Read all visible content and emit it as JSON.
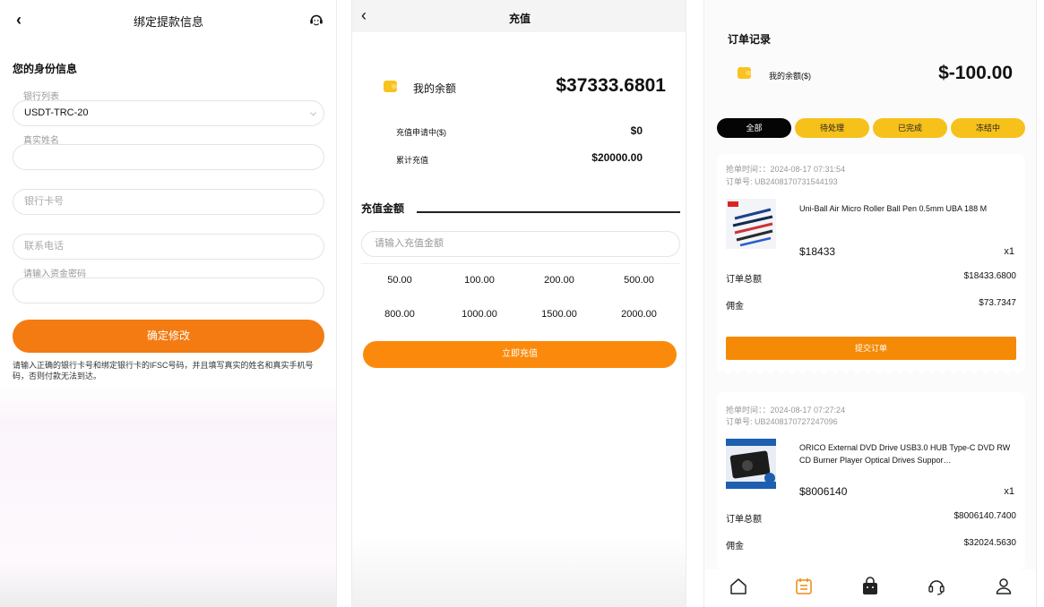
{
  "panel1": {
    "back_glyph": "‹",
    "title": "绑定提款信息",
    "section_title": "您的身份信息",
    "bank_list_label": "银行列表",
    "bank_list_value": "USDT-TRC-20",
    "real_name_label": "真实姓名",
    "card_placeholder": "银行卡号",
    "phone_placeholder": "联系电话",
    "fund_password_label": "请输入资金密码",
    "confirm_label": "确定修改",
    "note": "请输入正确的银行卡号和绑定银行卡的IFSC号码，并且填写真实的姓名和真实手机号码，否则付款无法到达。"
  },
  "panel2": {
    "back_glyph": "‹",
    "title": "充值",
    "balance_label": "我的余额",
    "balance_value": "$37333.6801",
    "pending_label": "充值申请中($)",
    "pending_value": "$0",
    "total_label": "累计充值",
    "total_value": "$20000.00",
    "amount_title": "充值金额",
    "amount_placeholder": "请输入充值金额",
    "presets": [
      "50.00",
      "100.00",
      "200.00",
      "500.00",
      "800.00",
      "1000.00",
      "1500.00",
      "2000.00"
    ],
    "recharge_label": "立即充值"
  },
  "panel3": {
    "title": "订单记录",
    "balance_label": "我的余额($)",
    "balance_value": "$-100.00",
    "tabs": [
      "全部",
      "待处理",
      "已完成",
      "冻结中"
    ],
    "orders": [
      {
        "time": "抢单时间：：2024-08-17 07:31:54",
        "order_no": "订单号: UB2408170731544193",
        "product": "Uni-Ball Air Micro Roller Ball Pen 0.5mm UBA 188 M",
        "price": "$18433",
        "qty": "x1",
        "total_label": "订单总额",
        "total_value": "$18433.6800",
        "commission_label": "佣金",
        "commission_value": "$73.7347",
        "submit_label": "提交订单"
      },
      {
        "time": "抢单时间：：2024-08-17 07:27:24",
        "order_no": "订单号: UB2408170727247096",
        "product": "ORICO External DVD Drive USB3.0 HUB Type-C DVD RW CD Burner Player Optical Drives Suppor…",
        "price": "$8006140",
        "qty": "x1",
        "total_label": "订单总额",
        "total_value": "$8006140.7400",
        "commission_label": "佣金",
        "commission_value": "$32024.5630"
      }
    ]
  },
  "colors": {
    "orange": "#f47b12",
    "yellow": "#f7c11b",
    "black": "#050505"
  },
  "icons": [
    "back-icon",
    "customer-service-icon",
    "wallet-icon",
    "home-icon",
    "orders-icon",
    "shop-bag-icon",
    "headset-icon",
    "profile-icon"
  ]
}
